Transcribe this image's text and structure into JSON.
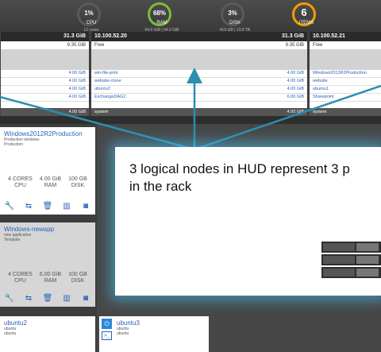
{
  "hud": {
    "cpu": {
      "value": "1%",
      "label": "CPU",
      "sub": "12 cores"
    },
    "ram": {
      "value": "68%",
      "label": "RAM",
      "sub": "64.0 GiB | 94.0 GiB"
    },
    "disk": {
      "value": "3%",
      "label": "DISK",
      "sub": "419 GB | 13.0 TB"
    },
    "items": {
      "value": "6",
      "label": "ITEMS"
    }
  },
  "nodes": [
    {
      "ip": "",
      "mem": "31.3 GiB",
      "free_label": "",
      "free_value": "9.35 GiB",
      "vms": [
        {
          "name": "",
          "mem": "4.00 GiB"
        },
        {
          "name": "",
          "mem": "4.00 GiB"
        },
        {
          "name": "",
          "mem": "4.00 GiB"
        },
        {
          "name": "",
          "mem": "4.00 GiB"
        }
      ],
      "system": {
        "label": "",
        "mem": "4.00 GiB"
      }
    },
    {
      "ip": "10.100.52.20",
      "mem": "31.3 GiB",
      "free_label": "Free",
      "free_value": "9.35 GiB",
      "vms": [
        {
          "name": "win-file-print",
          "mem": "4.00 GiB"
        },
        {
          "name": "website-clone",
          "mem": "4.00 GiB"
        },
        {
          "name": "ubuntu2",
          "mem": "4.00 GiB"
        },
        {
          "name": "ExchangeDAG2",
          "mem": "6.00 GiB"
        }
      ],
      "system": {
        "label": "system",
        "mem": "4.00 GiB"
      }
    },
    {
      "ip": "10.100.52.21",
      "mem": "",
      "free_label": "Free",
      "free_value": "",
      "vms": [
        {
          "name": "Windows2012R2Production",
          "mem": ""
        },
        {
          "name": "website",
          "mem": ""
        },
        {
          "name": "ubuntu1",
          "mem": ""
        },
        {
          "name": "Sharepoint",
          "mem": ""
        }
      ],
      "system": {
        "label": "system",
        "mem": ""
      }
    }
  ],
  "vm_cards": [
    {
      "name": "Windows2012R2Production",
      "desc1": "Production windows",
      "desc2": "Production",
      "cores": "4 CORES",
      "cores_lbl": "CPU",
      "ram": "4.00 GiB",
      "ram_lbl": "RAM",
      "disk": "100 GB",
      "disk_lbl": "DISK"
    },
    {
      "name": "Windows-newapp",
      "desc1": "new application",
      "desc2": "Template",
      "cores": "4 CORES",
      "cores_lbl": "CPU",
      "ram": "6.00 GiB",
      "ram_lbl": "RAM",
      "disk": "100 GB",
      "disk_lbl": "DISK"
    },
    {
      "name": "ubuntu2",
      "desc1": "ubuntu",
      "desc2": "ubuntu"
    },
    {
      "name": "ubuntu3",
      "desc1": "ubuntu",
      "desc2": "ubuntu"
    }
  ],
  "callout": {
    "text": "3 logical nodes in HUD represent 3 p\nin the rack"
  },
  "icons": [
    "wrench-icon",
    "migrate-icon",
    "trash-icon",
    "snapshot-icon",
    "console-icon"
  ],
  "colors": {
    "accent": "#2a62b8",
    "ram_ring": "#7dbb3a",
    "items_ring": "#f0a000",
    "glow": "#46c8ff"
  }
}
